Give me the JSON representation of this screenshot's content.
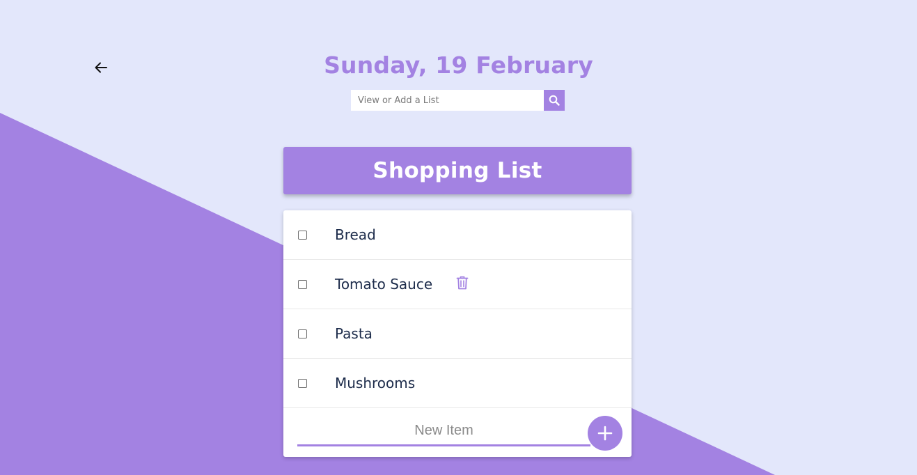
{
  "colors": {
    "accent": "#a382e2",
    "background": "#e3e7fb",
    "text": "#1c2b4a"
  },
  "header": {
    "back_icon": "arrow-left-icon",
    "date": "Sunday, 19 February"
  },
  "search": {
    "placeholder": "View or Add a List",
    "value": "",
    "icon": "search-icon"
  },
  "list": {
    "title": "Shopping List",
    "items": [
      {
        "label": "Bread",
        "checked": false
      },
      {
        "label": "Tomato Sauce",
        "checked": false,
        "hover_icon": "trash-icon"
      },
      {
        "label": "Pasta",
        "checked": false
      },
      {
        "label": "Mushrooms",
        "checked": false
      }
    ],
    "new_item": {
      "placeholder": "New Item",
      "value": ""
    },
    "add_icon": "plus-icon"
  }
}
